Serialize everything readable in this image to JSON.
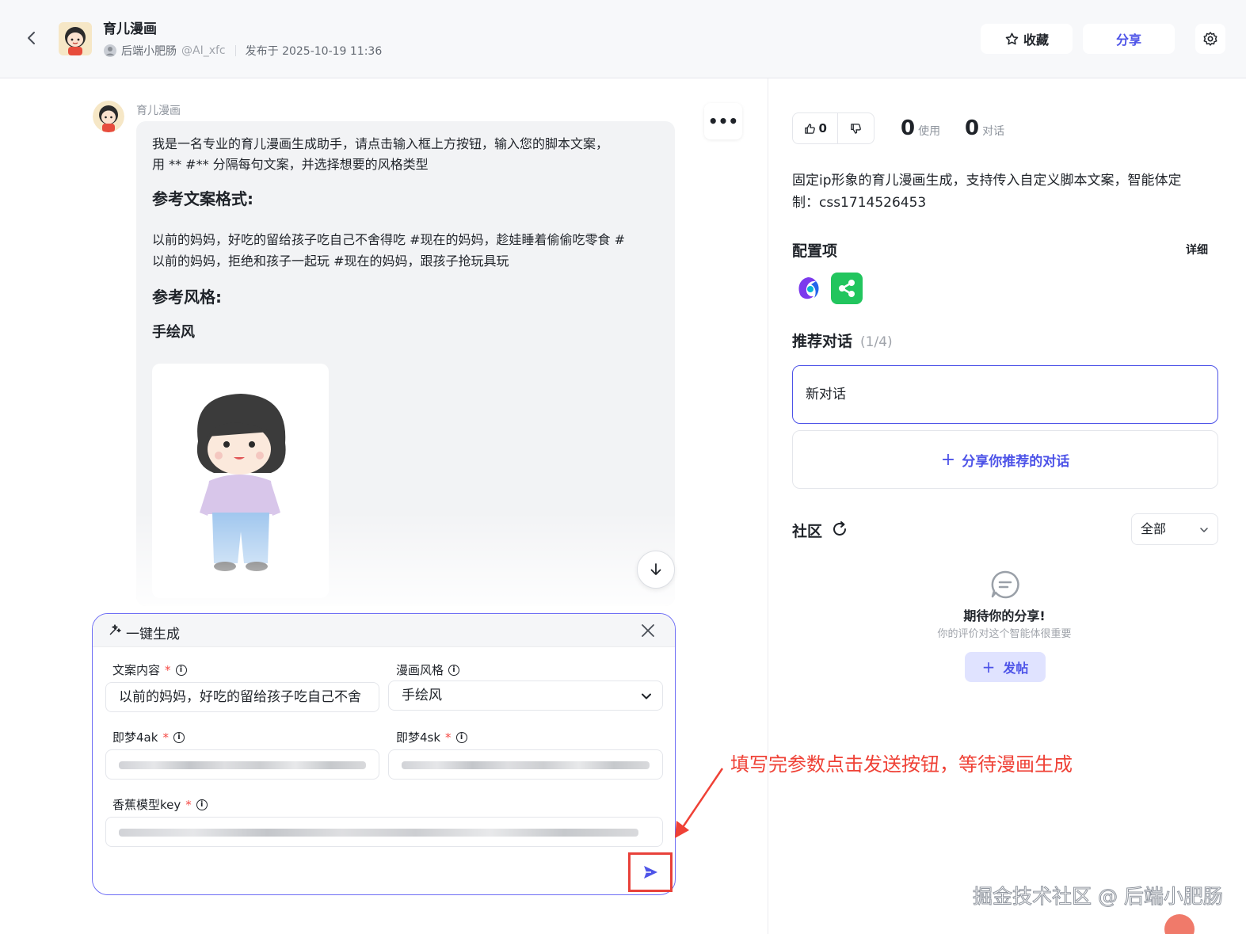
{
  "header": {
    "title": "育儿漫画",
    "author": "后端小肥肠",
    "handle": "@AI_xfc",
    "published": "发布于 2025-10-19 11:36",
    "favorite_label": "收藏",
    "share_label": "分享"
  },
  "chat": {
    "bot_name": "育儿漫画",
    "message": {
      "intro_line1": "我是一名专业的育儿漫画生成助手，请点击输入框上方按钮，输入您的脚本文案，",
      "intro_line2": "用 ** #** 分隔每句文案，并选择想要的风格类型",
      "heading_format": "参考文案格式:",
      "example_line1": "以前的妈妈，好吃的留给孩子吃自己不舍得吃 #现在的妈妈，趁娃睡着偷偷吃零食 #",
      "example_line2": "以前的妈妈，拒绝和孩子一起玩 #现在的妈妈，跟孩子抢玩具玩",
      "heading_style": "参考风格:",
      "style_value": "手绘风"
    }
  },
  "form": {
    "title": "一键生成",
    "fields": {
      "copy": {
        "label": "文案内容",
        "value": "以前的妈妈，好吃的留给孩子吃自己不舍"
      },
      "style": {
        "label": "漫画风格",
        "value": "手绘风"
      },
      "ak": {
        "label": "即梦4ak"
      },
      "sk": {
        "label": "即梦4sk"
      },
      "key": {
        "label": "香蕉模型key"
      }
    },
    "required_mark": "*",
    "info_mark": "i"
  },
  "annotation": "填写完参数点击发送按钮，等待漫画生成",
  "sidebar": {
    "likes": "0",
    "uses_count": "0",
    "uses_label": "使用",
    "chats_count": "0",
    "chats_label": "对话",
    "description": "固定ip形象的育儿漫画生成，支持传入自定义脚本文案，智能体定制：css1714526453",
    "config_title": "配置项",
    "config_detail": "详细",
    "recommend_title": "推荐对话",
    "recommend_count": "(1/4)",
    "new_chat": "新对话",
    "share_recommend": "分享你推荐的对话",
    "community_title": "社区",
    "filter_value": "全部",
    "empty_title": "期待你的分享!",
    "empty_sub": "你的评价对这个智能体很重要",
    "post_label": "发帖"
  },
  "watermark": "掘金技术社区 @ 后端小肥肠",
  "colors": {
    "accent": "#4d53e8",
    "annotation_red": "#ef4136",
    "required_red": "#f54a45",
    "plugin_green": "#22c55e"
  },
  "icons": [
    "back-icon",
    "star-icon",
    "gear-icon",
    "more-icon",
    "arrow-down-icon",
    "sparkle-icon",
    "close-icon",
    "info-icon",
    "chevron-down-icon",
    "send-icon",
    "thumbs-up-icon",
    "thumbs-down-icon",
    "refresh-icon",
    "chat-bubble-icon",
    "plus-icon"
  ]
}
